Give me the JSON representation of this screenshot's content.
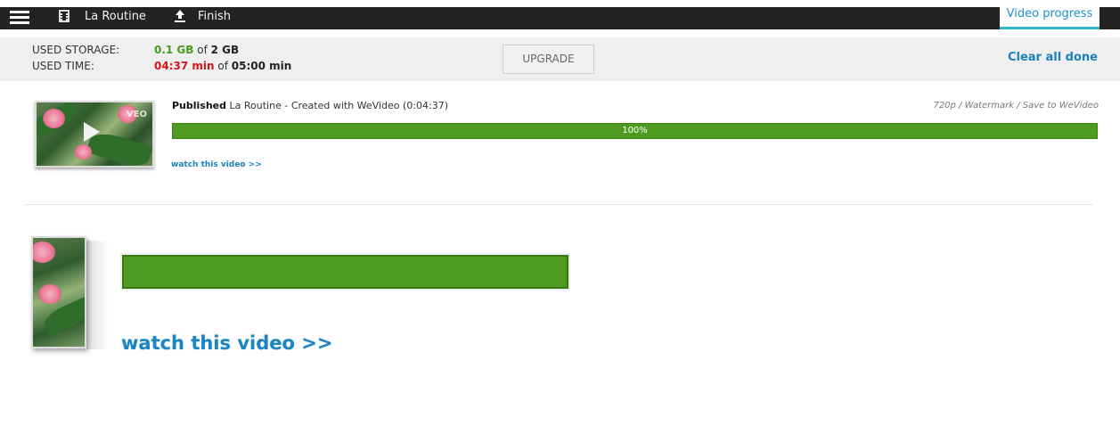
{
  "topbar": {
    "project_name": "La Routine",
    "finish_label": "Finish",
    "active_tab": "Video progress"
  },
  "usage": {
    "storage_label": "USED STORAGE:",
    "storage_used": "0.1 GB",
    "storage_sep": " of ",
    "storage_total": "2 GB",
    "time_label": "USED TIME:",
    "time_used": "04:37 min",
    "time_sep": " of ",
    "time_total": "05:00 min",
    "upgrade_label": "UPGRADE",
    "clear_label": "Clear all done"
  },
  "job": {
    "status": "Published",
    "title": " La Routine - Created with WeVideo (0:04:37)",
    "meta": "720p / Watermark / Save to WeVideo",
    "progress_text": "100%",
    "progress_value": 1.0,
    "watch_label": "watch this video >>"
  },
  "zoom": {
    "watch_label": "watch this video >>"
  },
  "icons": {
    "menu": "hamburger-menu-icon",
    "project": "film-icon",
    "finish": "upload-icon",
    "play": "play-icon"
  },
  "colors": {
    "accent_blue": "#1b7fc2",
    "success_green": "#4f9b21",
    "warning_red": "#d5151c",
    "topbar_dark": "#232323"
  }
}
